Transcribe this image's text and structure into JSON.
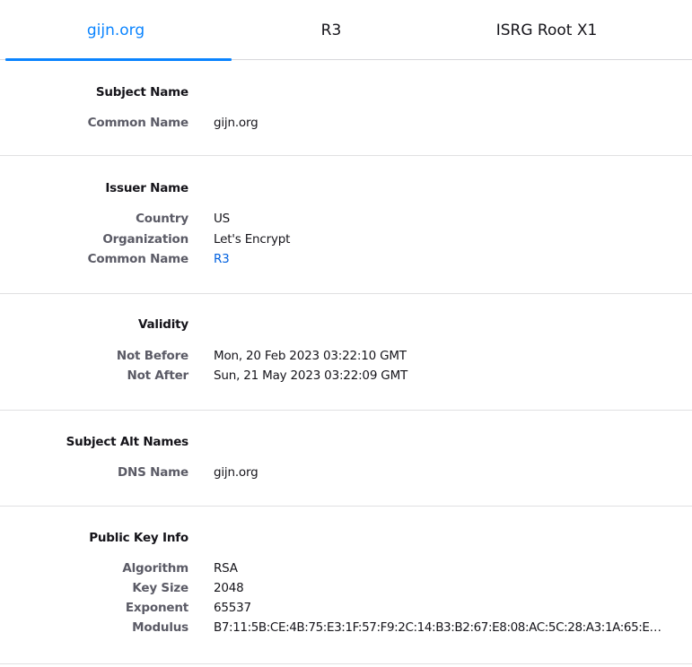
{
  "tabs": [
    {
      "label": "gijn.org",
      "selected": true
    },
    {
      "label": "R3",
      "selected": false
    },
    {
      "label": "ISRG Root X1",
      "selected": false
    }
  ],
  "subject_name": {
    "title": "Subject Name",
    "common_name_label": "Common Name",
    "common_name": "gijn.org"
  },
  "issuer_name": {
    "title": "Issuer Name",
    "country_label": "Country",
    "country": "US",
    "organization_label": "Organization",
    "organization": "Let's Encrypt",
    "common_name_label": "Common Name",
    "common_name": "R3"
  },
  "validity": {
    "title": "Validity",
    "not_before_label": "Not Before",
    "not_before": "Mon, 20 Feb 2023 03:22:10 GMT",
    "not_after_label": "Not After",
    "not_after": "Sun, 21 May 2023 03:22:09 GMT"
  },
  "subject_alt_names": {
    "title": "Subject Alt Names",
    "dns_name_label": "DNS Name",
    "dns_name": "gijn.org"
  },
  "public_key_info": {
    "title": "Public Key Info",
    "algorithm_label": "Algorithm",
    "algorithm": "RSA",
    "key_size_label": "Key Size",
    "key_size": "2048",
    "exponent_label": "Exponent",
    "exponent": "65537",
    "modulus_label": "Modulus",
    "modulus": "B7:11:5B:CE:4B:75:E3:1F:57:F9:2C:14:B3:B2:67:E8:08:AC:5C:28:A3:1A:65:E6:5…"
  },
  "colors": {
    "accent": "#0a84ff",
    "link": "#0060df",
    "label": "#5b5b66",
    "text": "#15141a"
  }
}
